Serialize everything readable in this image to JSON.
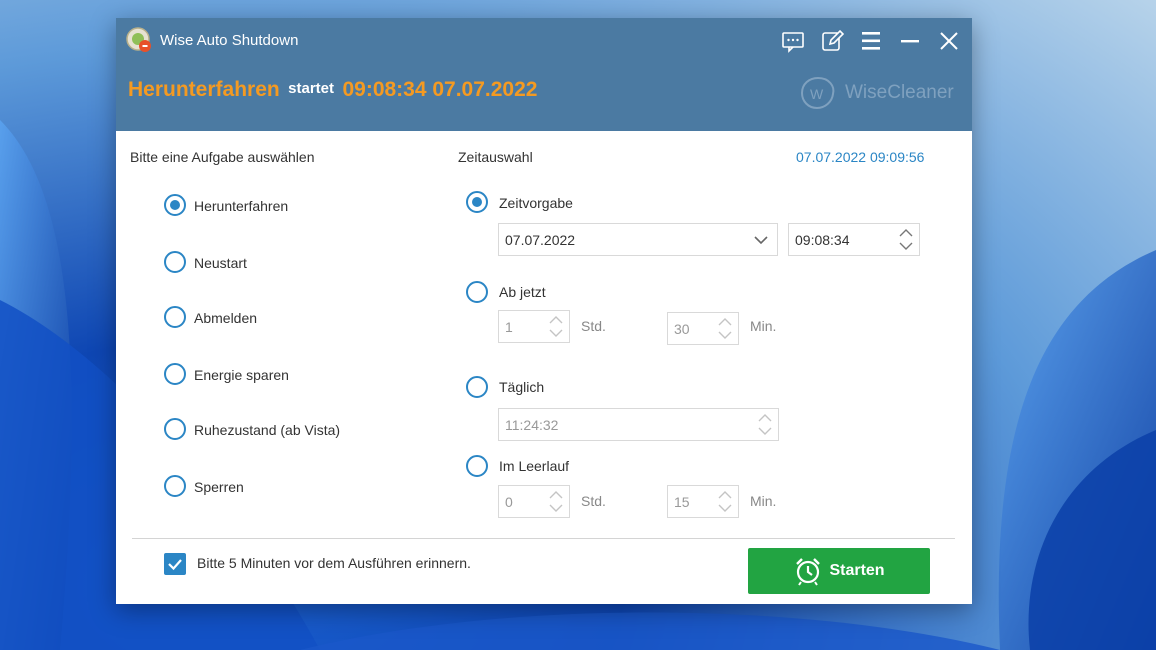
{
  "window": {
    "title": "Wise Auto Shutdown",
    "controls": [
      "feedback-icon",
      "edit-icon",
      "menu-icon",
      "minimize-icon",
      "close-icon"
    ]
  },
  "status": {
    "action": "Herunterfahren",
    "word": "startet",
    "time": "09:08:34 07.07.2022"
  },
  "brand": {
    "name": "WiseCleaner"
  },
  "tasks": {
    "heading": "Bitte eine Aufgabe auswählen",
    "items": [
      {
        "label": "Herunterfahren",
        "checked": true
      },
      {
        "label": "Neustart",
        "checked": false
      },
      {
        "label": "Abmelden",
        "checked": false
      },
      {
        "label": "Energie sparen",
        "checked": false
      },
      {
        "label": "Ruhezustand (ab Vista)",
        "checked": false
      },
      {
        "label": "Sperren",
        "checked": false
      }
    ]
  },
  "time_selection": {
    "heading": "Zeitauswahl",
    "clock": "07.07.2022 09:09:56",
    "preset": {
      "label": "Zeitvorgabe",
      "checked": true,
      "date": "07.07.2022",
      "time": "09:08:34"
    },
    "from_now": {
      "label": "Ab jetzt",
      "checked": false,
      "hours": "1",
      "hours_unit": "Std.",
      "minutes": "30",
      "minutes_unit": "Min."
    },
    "daily": {
      "label": "Täglich",
      "checked": false,
      "time": "11:24:32"
    },
    "idle": {
      "label": "Im Leerlauf",
      "checked": false,
      "hours": "0",
      "hours_unit": "Std.",
      "minutes": "15",
      "minutes_unit": "Min."
    }
  },
  "reminder": {
    "label": "Bitte 5 Minuten vor dem Ausführen erinnern.",
    "checked": true
  },
  "start_button": {
    "label": "Starten"
  },
  "colors": {
    "header": "#4b7aa2",
    "accent_orange": "#f49a22",
    "accent_blue": "#2b86c5",
    "start_green": "#22a442"
  }
}
